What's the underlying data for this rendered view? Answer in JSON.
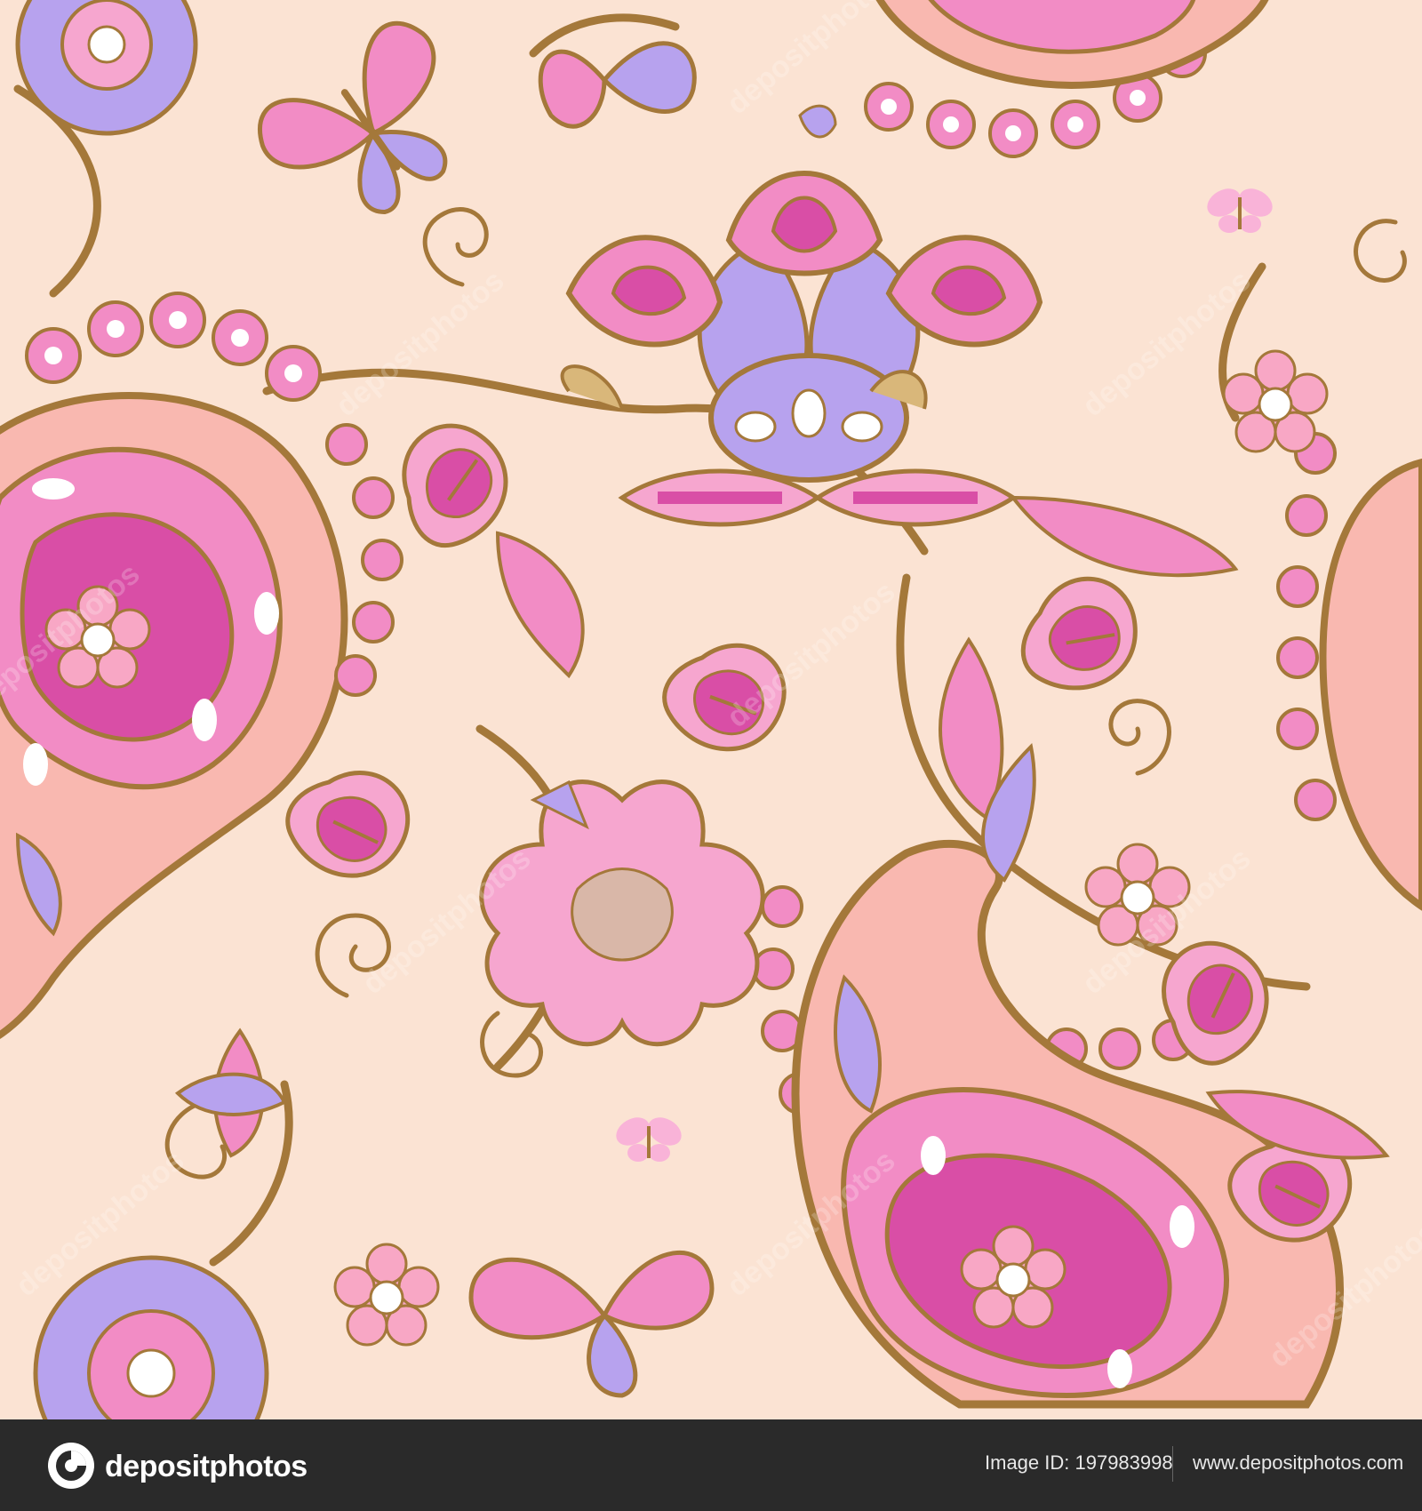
{
  "artwork": {
    "description_colors": {
      "background": "#fbe3d3",
      "pink": "#f28cc5",
      "magenta": "#d94ea6",
      "lavender": "#b7a2ee",
      "gold": "#a4783a",
      "light_gold": "#d9b77a",
      "peach": "#f9b8b0",
      "white": "#ffffff"
    },
    "watermark": "depositphotos"
  },
  "footer": {
    "logo_text": "depositphotos",
    "image_id": "Image ID: 197983998",
    "url": "www.depositphotos.com"
  }
}
